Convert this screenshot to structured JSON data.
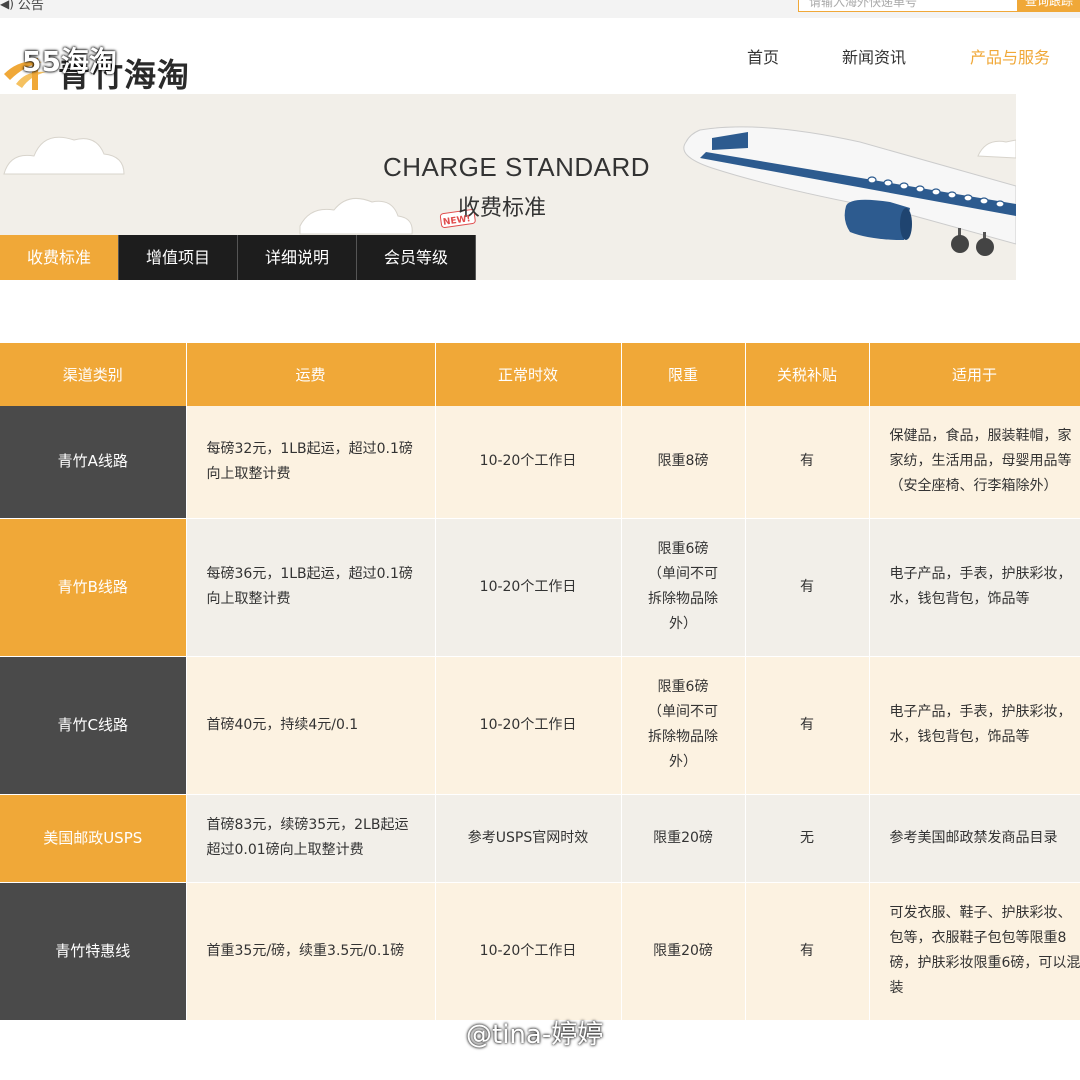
{
  "topbar": {
    "notice_icon": "volume-icon",
    "notice_label": "公告",
    "search_placeholder": "请输入海外快递单号",
    "search_button": "查询跟踪"
  },
  "header": {
    "logo_text": "青竹海淘",
    "logo_watermark": "55海淘",
    "nav": {
      "home": "首页",
      "news": "新闻资讯",
      "products": "产品与服务"
    }
  },
  "banner": {
    "title_en": "CHARGE STANDARD",
    "title_cn": "收费标准",
    "badge": "NEW!"
  },
  "tabs": [
    {
      "label": "收费标准",
      "active": true
    },
    {
      "label": "增值项目",
      "active": false
    },
    {
      "label": "详细说明",
      "active": false
    },
    {
      "label": "会员等级",
      "active": false
    }
  ],
  "table": {
    "headers": [
      "渠道类别",
      "运费",
      "正常时效",
      "限重",
      "关税补贴",
      "适用于"
    ],
    "rows": [
      {
        "channel": "青竹A线路",
        "fee": [
          "每磅32元，1LB起运，超过0.1磅",
          "向上取整计费"
        ],
        "time": "10-20个工作日",
        "limit": [
          "限重8磅"
        ],
        "subsidy": "有",
        "apply": [
          "保健品，食品，服装鞋帽，家",
          "家纺，生活用品，母婴用品等",
          "（安全座椅、行李箱除外）"
        ]
      },
      {
        "channel": "青竹B线路",
        "fee": [
          "每磅36元，1LB起运，超过0.1磅",
          "向上取整计费"
        ],
        "time": "10-20个工作日",
        "limit": [
          "限重6磅",
          "（单间不可",
          "拆除物品除",
          "外）"
        ],
        "subsidy": "有",
        "apply": [
          "电子产品，手表，护肤彩妆，",
          "水，钱包背包，饰品等"
        ]
      },
      {
        "channel": "青竹C线路",
        "fee": [
          "首磅40元，持续4元/0.1"
        ],
        "time": "10-20个工作日",
        "limit": [
          "限重6磅",
          "（单间不可",
          "拆除物品除",
          "外）"
        ],
        "subsidy": "有",
        "apply": [
          "电子产品，手表，护肤彩妆，",
          "水，钱包背包，饰品等"
        ]
      },
      {
        "channel": "美国邮政USPS",
        "fee": [
          "首磅83元，续磅35元，2LB起运",
          "超过0.01磅向上取整计费"
        ],
        "time": "参考USPS官网时效",
        "limit": [
          "限重20磅"
        ],
        "subsidy": "无",
        "apply": [
          "参考美国邮政禁发商品目录"
        ]
      },
      {
        "channel": "青竹特惠线",
        "fee": [
          "首重35元/磅，续重3.5元/0.1磅"
        ],
        "time": "10-20个工作日",
        "limit": [
          "限重20磅"
        ],
        "subsidy": "有",
        "apply": [
          "可发衣服、鞋子、护肤彩妆、",
          "包等，衣服鞋子包包等限重8",
          "磅，护肤彩妆限重6磅，可以混",
          "装"
        ]
      }
    ]
  },
  "watermark": "@tina-婷婷",
  "colors": {
    "accent": "#f0a838",
    "dark": "#4a4a4a",
    "tab_dark": "#1d1d1d",
    "row_light": "#fcf2e1",
    "row_grey": "#f2efe9"
  }
}
